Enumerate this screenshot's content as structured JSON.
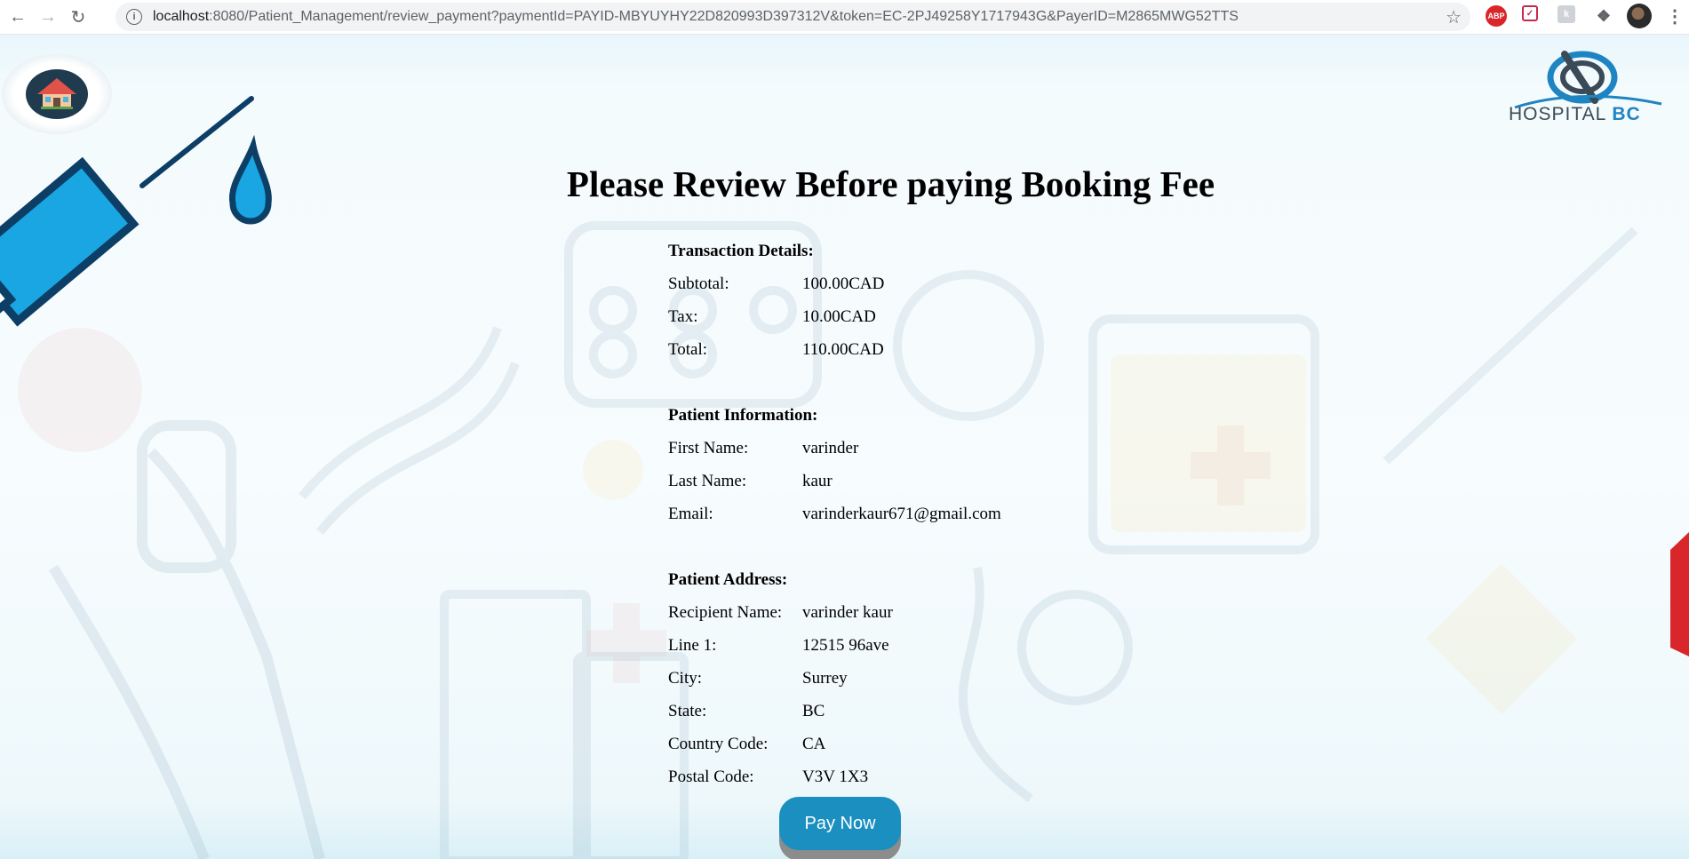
{
  "browser": {
    "url_host": "localhost",
    "url_rest": ":8080/Patient_Management/review_payment?paymentId=PAYID-MBYUYHY22D820993D397312V&token=EC-2PJ49258Y1717943G&PayerID=M2865MWG52TTS",
    "extensions": [
      "abp-icon",
      "pocket-icon",
      "k-icon",
      "puzzle-icon",
      "profile-avatar",
      "menu-icon"
    ],
    "abp_label": "ABP"
  },
  "header": {
    "logo_text": "HOSPITAL",
    "logo_text_bc": "BC"
  },
  "page": {
    "title": "Please Review Before paying Booking Fee"
  },
  "transaction": {
    "heading": "Transaction Details:",
    "rows": [
      {
        "label": "Subtotal:",
        "value": "100.00CAD"
      },
      {
        "label": "Tax:",
        "value": "10.00CAD"
      },
      {
        "label": "Total:",
        "value": "110.00CAD"
      }
    ]
  },
  "patient": {
    "heading": "Patient Information:",
    "rows": [
      {
        "label": "First Name:",
        "value": "varinder"
      },
      {
        "label": "Last Name:",
        "value": "kaur"
      },
      {
        "label": "Email:",
        "value": "varinderkaur671@gmail.com"
      }
    ]
  },
  "address": {
    "heading": "Patient Address:",
    "rows": [
      {
        "label": "Recipient Name:",
        "value": "varinder kaur"
      },
      {
        "label": "Line 1:",
        "value": "12515 96ave"
      },
      {
        "label": "City:",
        "value": "Surrey"
      },
      {
        "label": "State:",
        "value": "BC"
      },
      {
        "label": "Country Code:",
        "value": "CA"
      },
      {
        "label": "Postal Code:",
        "value": "V3V 1X3"
      }
    ]
  },
  "actions": {
    "pay_label": "Pay Now"
  },
  "colors": {
    "pay_button": "#1a8fc0",
    "logo_blue": "#1f84c2"
  }
}
